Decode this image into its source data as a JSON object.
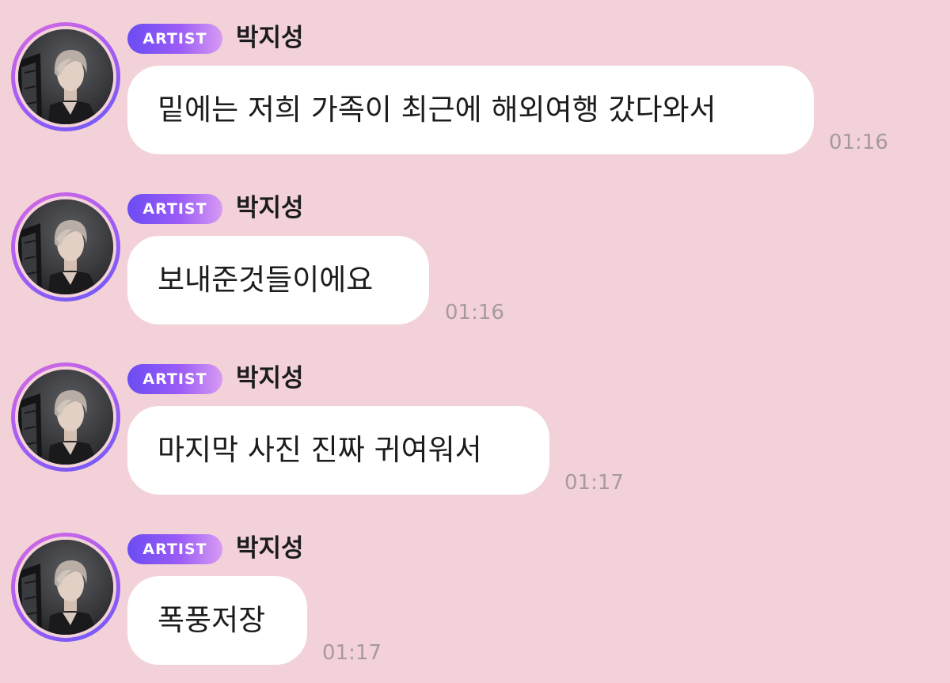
{
  "chat": {
    "messages": [
      {
        "badge": "ARTIST",
        "sender": "박지성",
        "text": "밑에는 저희 가족이 최근에 해외여행 갔다와서",
        "time": "01:16"
      },
      {
        "badge": "ARTIST",
        "sender": "박지성",
        "text": "보내준것들이에요",
        "time": "01:16"
      },
      {
        "badge": "ARTIST",
        "sender": "박지성",
        "text": "마지막 사진 진짜 귀여워서",
        "time": "01:17"
      },
      {
        "badge": "ARTIST",
        "sender": "박지성",
        "text": "폭풍저장",
        "time": "01:17"
      }
    ]
  },
  "colors": {
    "background": "#f2d2d8",
    "bubble": "#ffffff",
    "badge_start": "#6b4cf4",
    "badge_end": "#d79bf3",
    "avatar_ring": "#a35cf5",
    "timestamp": "#a79a9f"
  },
  "icons": {
    "avatar": "profile-photo"
  }
}
